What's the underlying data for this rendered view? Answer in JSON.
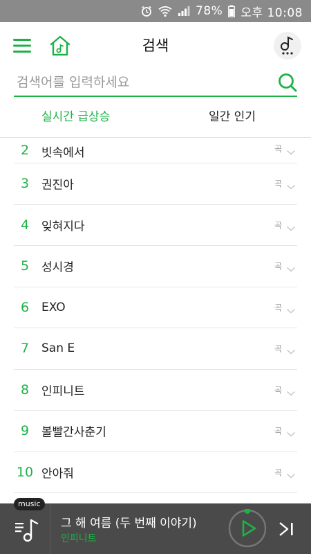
{
  "status": {
    "battery": "78%",
    "time": "오후 10:08"
  },
  "header": {
    "title": "검색",
    "menu_icon": "hamburger-menu-icon",
    "home_icon": "home-music-icon",
    "music_icon": "music-note-icon"
  },
  "search": {
    "placeholder": "검색어를 입력하세요",
    "value": ""
  },
  "tabs": [
    {
      "label": "실시간 급상승",
      "active": true
    },
    {
      "label": "일간 인기",
      "active": false
    }
  ],
  "list": [
    {
      "rank": "2",
      "name": "빗속에서",
      "kind": "곡"
    },
    {
      "rank": "3",
      "name": "권진아",
      "kind": "곡"
    },
    {
      "rank": "4",
      "name": "잊혀지다",
      "kind": "곡"
    },
    {
      "rank": "5",
      "name": "성시경",
      "kind": "곡"
    },
    {
      "rank": "6",
      "name": "EXO",
      "kind": "곡"
    },
    {
      "rank": "7",
      "name": "San E",
      "kind": "곡"
    },
    {
      "rank": "8",
      "name": "인피니트",
      "kind": "곡"
    },
    {
      "rank": "9",
      "name": "볼빨간사춘기",
      "kind": "곡"
    },
    {
      "rank": "10",
      "name": "안아줘",
      "kind": "곡"
    }
  ],
  "player": {
    "badge": "music",
    "song": "그 해 여름 (두 번째 이야기)",
    "artist": "인피니트"
  },
  "colors": {
    "accent": "#1db247",
    "statusbar": "#8a8a8a",
    "player_bg": "#4a4a4a"
  }
}
